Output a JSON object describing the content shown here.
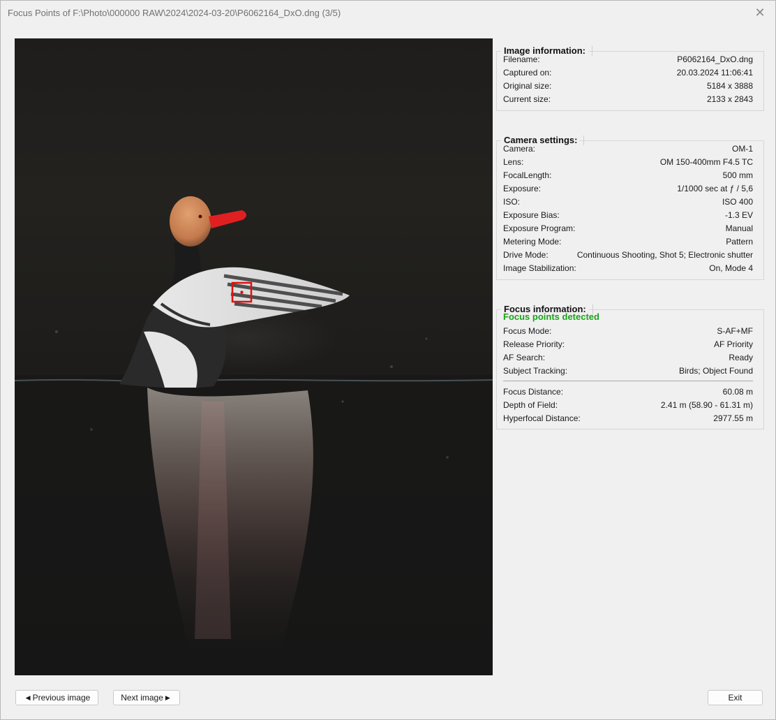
{
  "window": {
    "title": "Focus Points of F:\\Photo\\000000 RAW\\2024\\2024-03-20\\P6062164_DxO.dng (3/5)",
    "close_glyph": "✕"
  },
  "image_info": {
    "heading": "Image information:",
    "rows": [
      {
        "label": "Filename:",
        "value": "P6062164_DxO.dng"
      },
      {
        "label": "Captured on:",
        "value": "20.03.2024 11:06:41"
      },
      {
        "label": "Original size:",
        "value": "5184 x 3888"
      },
      {
        "label": "Current size:",
        "value": "2133 x 2843"
      }
    ]
  },
  "camera_settings": {
    "heading": "Camera settings:",
    "rows": [
      {
        "label": "Camera:",
        "value": "OM-1"
      },
      {
        "label": "Lens:",
        "value": "OM 150-400mm F4.5 TC"
      },
      {
        "label": "FocalLength:",
        "value": "500 mm"
      },
      {
        "label": "Exposure:",
        "value": "1/1000 sec at ƒ / 5,6"
      },
      {
        "label": "ISO:",
        "value": "ISO 400"
      },
      {
        "label": "Exposure Bias:",
        "value": "-1.3 EV"
      },
      {
        "label": "Exposure Program:",
        "value": "Manual"
      },
      {
        "label": "Metering Mode:",
        "value": "Pattern"
      },
      {
        "label": "Drive Mode:",
        "value": "Continuous Shooting, Shot 5; Electronic shutter"
      },
      {
        "label": "Image Stabilization:",
        "value": "On, Mode 4"
      }
    ]
  },
  "focus_info": {
    "heading": "Focus information:",
    "status": "Focus points detected",
    "rows": [
      {
        "label": "Focus Mode:",
        "value": "S-AF+MF"
      },
      {
        "label": "Release Priority:",
        "value": "AF Priority"
      },
      {
        "label": "AF Search:",
        "value": "Ready"
      },
      {
        "label": "Subject Tracking:",
        "value": "Birds; Object Found"
      }
    ],
    "distance_rows": [
      {
        "label": "Focus Distance:",
        "value": "60.08 m"
      },
      {
        "label": "Depth of Field:",
        "value": "2.41 m (58.90 - 61.31 m)"
      },
      {
        "label": "Hyperfocal Distance:",
        "value": "2977.55 m"
      }
    ]
  },
  "buttons": {
    "previous": "Previous image",
    "next": "Next image",
    "exit": "Exit",
    "previous_icon": "◀",
    "next_icon": "▶"
  },
  "colors": {
    "focus_point": "#e01010",
    "status_ok": "#1aa31a"
  }
}
